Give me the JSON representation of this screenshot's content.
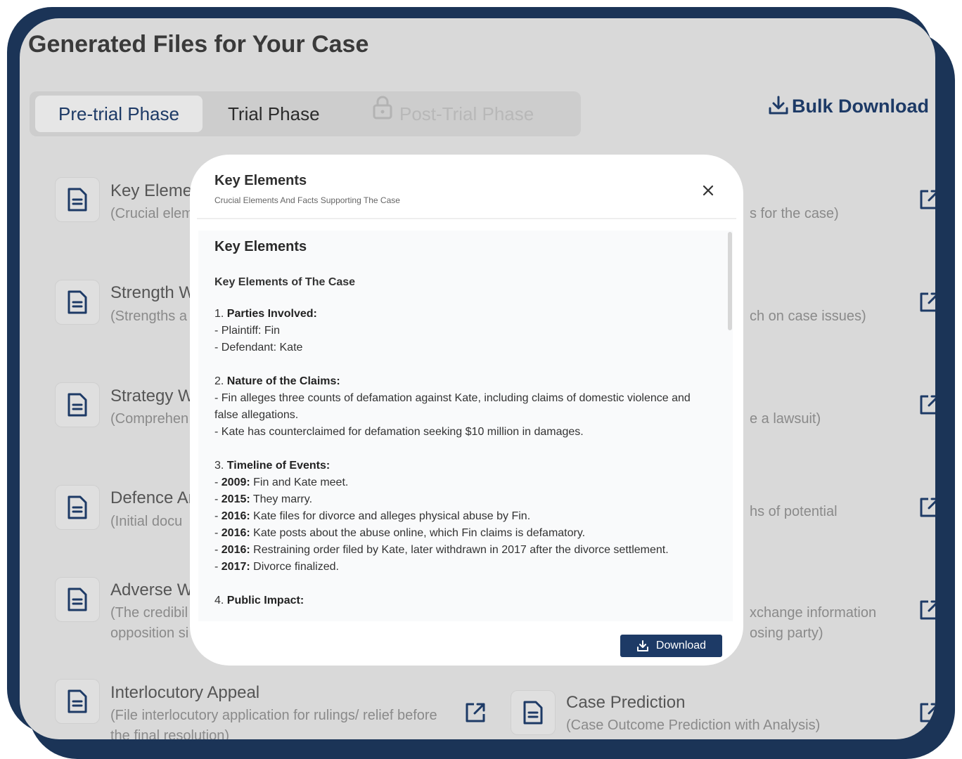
{
  "page": {
    "title": "Generated Files for Your Case",
    "bulk_download": "Bulk Download"
  },
  "tabs": [
    {
      "label": "Pre-trial Phase",
      "active": true
    },
    {
      "label": "Trial Phase",
      "active": false
    },
    {
      "label": "Post-Trial Phase",
      "locked": true
    }
  ],
  "left_items": [
    {
      "title": "Key Elemen",
      "desc": "(Crucial elem"
    },
    {
      "title": "Strength W",
      "desc": "(Strengths a"
    },
    {
      "title": "Strategy W",
      "desc": "(Comprehen"
    },
    {
      "title": "Defence Ar",
      "desc": "(Initial docu"
    },
    {
      "title": "Adverse Wi",
      "desc": "(The credibil opposition si"
    },
    {
      "title": "Interlocutory Appeal",
      "desc": "(File interlocutory application for rulings/ relief before the final resolution)"
    }
  ],
  "right_items": [
    {
      "desc": "s for the case)"
    },
    {
      "desc": "ch on case issues)"
    },
    {
      "desc": "e a lawsuit)"
    },
    {
      "desc": "hs of potential"
    },
    {
      "desc": "xchange information osing party)"
    },
    {
      "title": "Case Prediction",
      "desc": "(Case Outcome Prediction with Analysis)"
    }
  ],
  "modal": {
    "title": "Key Elements",
    "subtitle": "Crucial Elements And Facts Supporting The Case",
    "heading": "Key Elements",
    "subheading": "Key Elements of The Case",
    "s1_num": "1. ",
    "s1_title": "Parties Involved:",
    "s1_l1": "- Plaintiff: Fin",
    "s1_l2": "- Defendant: Kate",
    "s2_num": "2. ",
    "s2_title": "Nature of the Claims:",
    "s2_l1": "- Fin alleges three counts of defamation against Kate, including claims of domestic violence and false allegations.",
    "s2_l2": "- Kate has counterclaimed for defamation seeking $10 million in damages.",
    "s3_num": "3. ",
    "s3_title": "Timeline of Events:",
    "timeline": [
      {
        "year": "2009:",
        "text": " Fin and Kate meet."
      },
      {
        "year": "2015:",
        "text": " They marry."
      },
      {
        "year": "2016:",
        "text": " Kate files for divorce and alleges physical abuse by Fin."
      },
      {
        "year": "2016:",
        "text": " Kate posts about the abuse online, which Fin claims is defamatory."
      },
      {
        "year": "2016:",
        "text": " Restraining order filed by Kate, later withdrawn in 2017 after the divorce settlement."
      },
      {
        "year": "2017:",
        "text": " Divorce finalized."
      }
    ],
    "s4_num": "4. ",
    "s4_title": "Public Impact:",
    "download": "Download"
  }
}
